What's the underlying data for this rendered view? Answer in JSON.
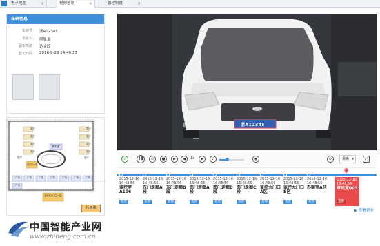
{
  "tabs": [
    {
      "label": "电子地图"
    },
    {
      "label": "视频信息"
    },
    {
      "label": "管理制度"
    }
  ],
  "vehicle_panel": {
    "title": "车辆信息",
    "fields": [
      {
        "label": "车牌号：",
        "value": "浙A12345"
      },
      {
        "label": "驾驶人：",
        "value": "周星星"
      },
      {
        "label": "副车驾驶：",
        "value": "达文西"
      },
      {
        "label": "登记时间：",
        "value": "2016-9-28 14:40:37"
      }
    ]
  },
  "floor_plan": {
    "rooms": [
      "展厅",
      "展厅",
      "展厅",
      "展厅",
      "展厅",
      "展厅",
      "展厅",
      "展厅",
      "展厅",
      "展厅",
      "广场",
      "广场",
      "广场",
      "广场",
      "广场",
      "广场",
      "广场",
      "广场"
    ],
    "building_label": "教学楼",
    "main_gate": "政府东大门口(A区)",
    "side_label": "地下停车场",
    "button": "行进线"
  },
  "video": {
    "plate_text": "浙A12345"
  },
  "controls": {
    "speed": "1x",
    "quality": "清晰"
  },
  "timeline": {
    "events": [
      {
        "time": "2015-12-16 16:48:56",
        "place": "监控室A106",
        "view": "查看"
      },
      {
        "time": "2015-12-16 16:48:56",
        "place": "东门走廊A段",
        "view": "查看"
      },
      {
        "time": "2015-12-16 16:48:56",
        "place": "东门走廊B段",
        "view": "查看"
      },
      {
        "time": "2015-12-16 16:48:56",
        "place": "南门走廊A段",
        "view": "查看"
      },
      {
        "time": "2015-12-16 16:48:56",
        "place": "南门走廊B段",
        "view": "查看"
      },
      {
        "time": "2015-12-16 16:48:56",
        "place": "南门走廊C段",
        "view": "查看"
      },
      {
        "time": "2015-12-16 16:48:56",
        "place": "监控大门口A区",
        "view": "查看"
      },
      {
        "time": "2015-12-16 16:48:56",
        "place": "监控大门口B区",
        "view": "查看"
      },
      {
        "time": "2015-12-16 16:48:56",
        "place": "办案室A区",
        "view": "查看"
      },
      {
        "time": "2015-12-16 16:48:56",
        "place": "审讯室003",
        "view": "查看"
      }
    ],
    "more": "查看更多"
  },
  "logo": {
    "cn": "中国智能产业网",
    "en": "www.zhineng.com.cn"
  },
  "colors": {
    "accent": "#3f8edb",
    "highlight": "#e84c4c"
  }
}
